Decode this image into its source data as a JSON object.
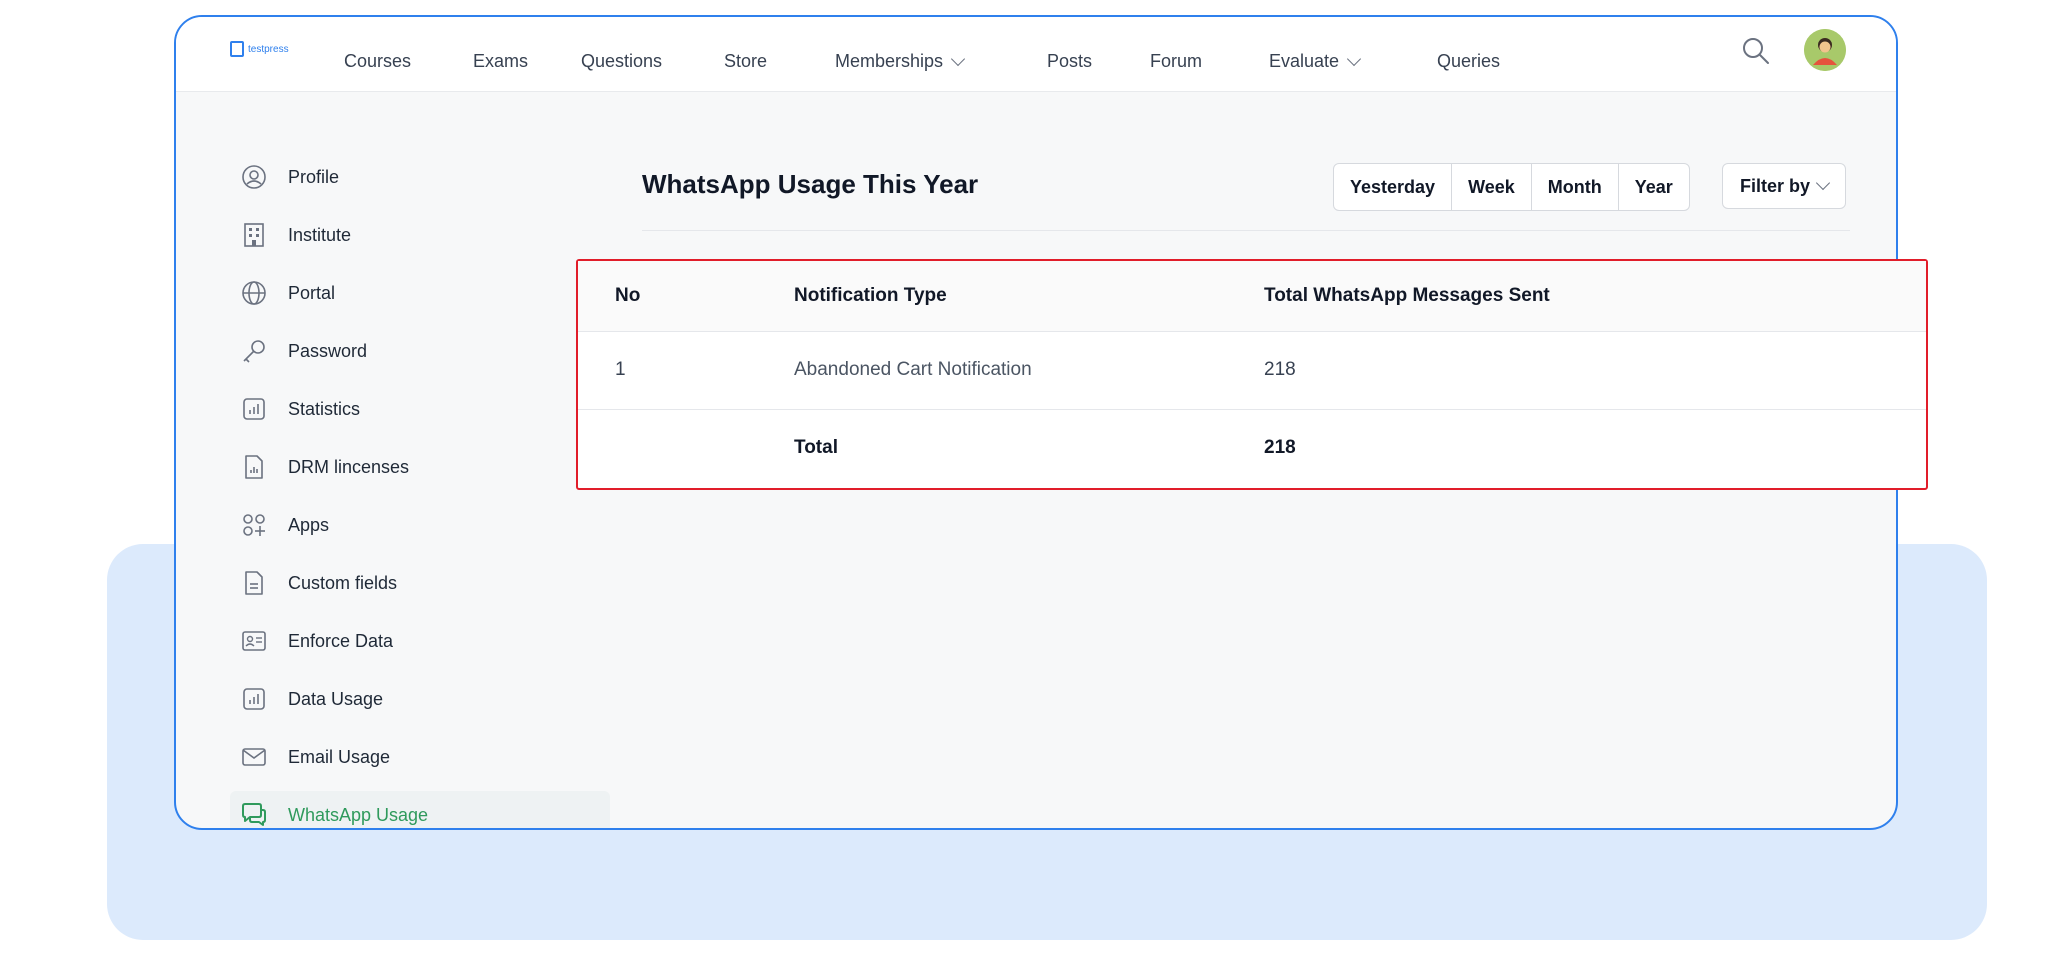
{
  "nav": {
    "logo_text": "testpress",
    "items": [
      "Courses",
      "Exams",
      "Questions",
      "Store",
      "Memberships",
      "Posts",
      "Forum",
      "Evaluate",
      "Queries"
    ]
  },
  "sidebar": {
    "items": [
      {
        "label": "Profile",
        "icon": "profile-icon"
      },
      {
        "label": "Institute",
        "icon": "building-icon"
      },
      {
        "label": "Portal",
        "icon": "globe-icon"
      },
      {
        "label": "Password",
        "icon": "key-icon"
      },
      {
        "label": "Statistics",
        "icon": "chart-icon"
      },
      {
        "label": "DRM lincenses",
        "icon": "document-chart-icon"
      },
      {
        "label": "Apps",
        "icon": "apps-icon"
      },
      {
        "label": "Custom fields",
        "icon": "document-icon"
      },
      {
        "label": "Enforce Data",
        "icon": "id-card-icon"
      },
      {
        "label": "Data Usage",
        "icon": "chart-icon"
      },
      {
        "label": "Email Usage",
        "icon": "mail-icon"
      },
      {
        "label": "WhatsApp Usage",
        "icon": "chat-icon",
        "active": true
      }
    ]
  },
  "main": {
    "title": "WhatsApp Usage This Year",
    "periods": [
      "Yesterday",
      "Week",
      "Month",
      "Year"
    ],
    "filter_label": "Filter by"
  },
  "table": {
    "headers": [
      "No",
      "Notification Type",
      "Total WhatsApp Messages Sent"
    ],
    "rows": [
      [
        "1",
        "Abandoned Cart Notification",
        "218"
      ]
    ],
    "total": {
      "label": "Total",
      "value": "218"
    }
  },
  "colors": {
    "accent": "#2f80ed",
    "active_green": "#2f9a5c",
    "highlight_red": "#e11d2a",
    "panel_blue": "#dceafc"
  }
}
